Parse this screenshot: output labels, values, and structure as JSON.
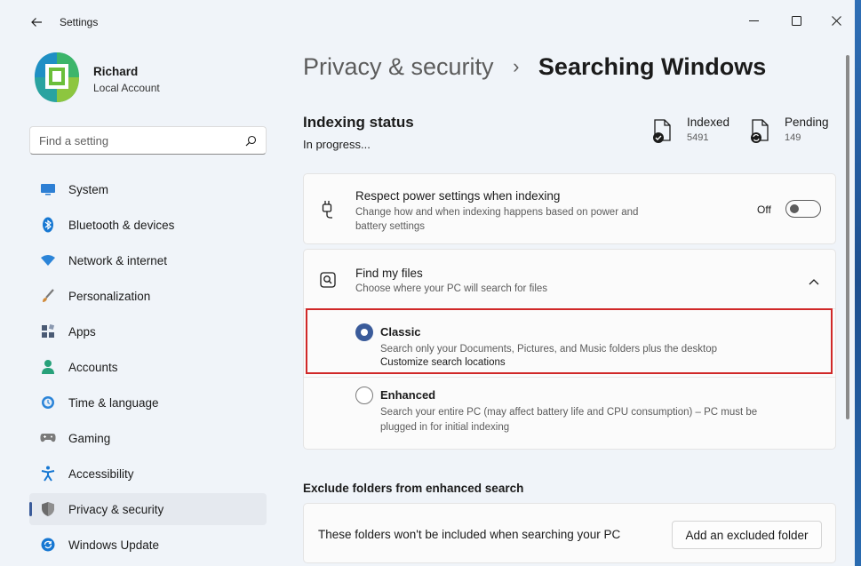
{
  "window": {
    "title": "Settings"
  },
  "profile": {
    "name": "Richard",
    "account_type": "Local Account"
  },
  "search": {
    "placeholder": "Find a setting"
  },
  "nav": {
    "items": [
      {
        "label": "System",
        "icon": "monitor-icon",
        "color": "#2d7fd4"
      },
      {
        "label": "Bluetooth & devices",
        "icon": "bluetooth-icon",
        "color": "#1677d2"
      },
      {
        "label": "Network & internet",
        "icon": "wifi-icon",
        "color": "#2b84d8"
      },
      {
        "label": "Personalization",
        "icon": "brush-icon",
        "color": "#d08a3a"
      },
      {
        "label": "Apps",
        "icon": "apps-icon",
        "color": "#4a5a74"
      },
      {
        "label": "Accounts",
        "icon": "person-icon",
        "color": "#27a17a"
      },
      {
        "label": "Time & language",
        "icon": "clock-globe-icon",
        "color": "#2b84d8"
      },
      {
        "label": "Gaming",
        "icon": "gamepad-icon",
        "color": "#7a7a7a"
      },
      {
        "label": "Accessibility",
        "icon": "accessibility-icon",
        "color": "#1677d2"
      },
      {
        "label": "Privacy & security",
        "icon": "shield-icon",
        "color": "#6b6b6b",
        "active": true
      },
      {
        "label": "Windows Update",
        "icon": "update-icon",
        "color": "#1677d2"
      }
    ]
  },
  "breadcrumb": {
    "parent": "Privacy & security",
    "separator": "›",
    "current": "Searching Windows"
  },
  "indexing": {
    "title": "Indexing status",
    "status": "In progress...",
    "indexed_label": "Indexed",
    "indexed_value": "5491",
    "pending_label": "Pending",
    "pending_value": "149"
  },
  "power": {
    "title": "Respect power settings when indexing",
    "desc_line1": "Change how and when indexing happens based on power and",
    "desc_line2": "battery settings",
    "toggle_label": "Off",
    "toggle_on": false
  },
  "find": {
    "title": "Find my files",
    "desc": "Choose where your PC will search for files",
    "options": [
      {
        "title": "Classic",
        "desc": "Search only your Documents, Pictures, and Music folders plus the desktop",
        "link": "Customize search locations",
        "selected": true
      },
      {
        "title": "Enhanced",
        "desc_line1": "Search your entire PC (may affect battery life and CPU consumption) – PC must be",
        "desc_line2": "plugged in for initial indexing",
        "selected": false
      }
    ]
  },
  "exclude": {
    "heading": "Exclude folders from enhanced search",
    "text": "These folders won't be included when searching your PC",
    "button": "Add an excluded folder"
  },
  "colors": {
    "accent": "#3a5b9a",
    "highlight": "#d02828"
  }
}
